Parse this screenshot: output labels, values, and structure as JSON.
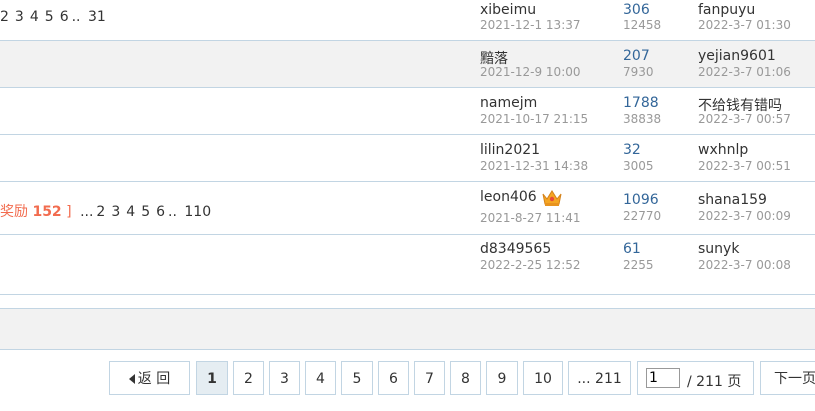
{
  "rows": [
    {
      "pages_prefix": "",
      "pages": [
        "2",
        "3",
        "4",
        "5",
        "6"
      ],
      "pages_ellipsis": "..",
      "pages_last": "31",
      "author": "xibeimu",
      "author_date": "2021-12-1 13:37",
      "replies": "306",
      "views": "12458",
      "last_user": "fanpuyu",
      "last_date": "2022-3-7 01:30",
      "highlight": false
    },
    {
      "author": "黯落",
      "author_date": "2021-12-9 10:00",
      "replies": "207",
      "views": "7930",
      "last_user": "yejian9601",
      "last_date": "2022-3-7 01:06",
      "highlight": true
    },
    {
      "author": "namejm",
      "author_date": "2021-10-17 21:15",
      "replies": "1788",
      "views": "38838",
      "last_user": "不给钱有错吗",
      "last_date": "2022-3-7 00:57",
      "highlight": false
    },
    {
      "author": "lilin2021",
      "author_date": "2021-12-31 14:38",
      "replies": "32",
      "views": "3005",
      "last_user": "wxhnlp",
      "last_date": "2022-3-7 00:51",
      "highlight": false
    },
    {
      "reward_label": "奖励",
      "reward_value": "152",
      "reward_close": "]",
      "pages_prefix": "...",
      "pages": [
        "2",
        "3",
        "4",
        "5",
        "6"
      ],
      "pages_ellipsis": "..",
      "pages_last": "110",
      "author": "leon406",
      "author_icon": "crown-icon",
      "author_date": "2021-8-27 11:41",
      "replies": "1096",
      "views": "22770",
      "last_user": "shana159",
      "last_date": "2022-3-7 00:09",
      "highlight": false
    },
    {
      "author": "d8349565",
      "author_date": "2022-2-25 12:52",
      "replies": "61",
      "views": "2255",
      "last_user": "sunyk",
      "last_date": "2022-3-7 00:08",
      "highlight": false
    }
  ],
  "pagination": {
    "back_label": "返 回",
    "back_icon": "triangle-left-icon",
    "pages": [
      "1",
      "2",
      "3",
      "4",
      "5",
      "6",
      "7",
      "8",
      "9",
      "10"
    ],
    "current": "1",
    "ellipsis_last": "... 211",
    "page_input_value": "1",
    "total_label": "/ 211 页",
    "next_label": "下一页"
  },
  "colors": {
    "border": "#c2d5e3",
    "link_blue": "#336699",
    "reward_red": "#f26c4f",
    "highlight_bg": "#f2f2f2"
  }
}
